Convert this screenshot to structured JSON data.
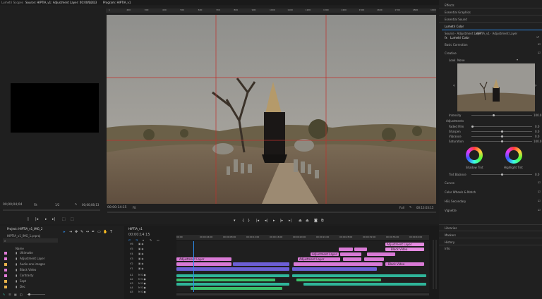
{
  "top_tabs": {
    "left_tab": "Lumetri Scopes",
    "source_tab": "Source: HIPTIA_v1: Adjustment Layer: 00:00:10:13",
    "audio_tab": "Audi",
    "program_tab": "Program: HIPTIA_v1"
  },
  "ruler_labels": [
    "1",
    "200",
    "300",
    "400",
    "500",
    "600",
    "700",
    "800",
    "900",
    "1000",
    "1100",
    "1200",
    "1300",
    "1400",
    "1500",
    "1600",
    "1700",
    "1800",
    "1900"
  ],
  "source_monitor": {
    "timecode": "00;00;04;04",
    "fit": "Fit",
    "resolution": "1/2",
    "duration": "00;00;08;13"
  },
  "program_monitor": {
    "timecode": "00:00:14:15",
    "fit": "Fit",
    "resolution": "Full",
    "duration": "00:13:03:15"
  },
  "right_panel": {
    "effects": "Effects",
    "essential_graphics": "Essential Graphics",
    "essential_sound": "Essential Sound",
    "lumetri_color": "Lumetri Color",
    "source_line": "Source · Adjustment Layer",
    "sequence_line": "HIPTIA_v1 · Adjustment Layer",
    "effect_name": "Lumetri Color",
    "basic_correction": "Basic Correction",
    "creative": "Creative",
    "look_label": "Look",
    "look_value": "None",
    "intensity": "Intensity",
    "intensity_val": "100.0",
    "adjustments": "Adjustments",
    "faded_film": "Faded Film",
    "faded_film_val": "0.0",
    "sharpen": "Sharpen",
    "sharpen_val": "0.0",
    "vibrance": "Vibrance",
    "vibrance_val": "0.0",
    "saturation": "Saturation",
    "saturation_val": "100.0",
    "shadow_tint": "Shadow Tint",
    "highlight_tint": "Highlight Tint",
    "tint_balance": "Tint Balance",
    "tint_balance_val": "0.0",
    "curves": "Curves",
    "color_wheels": "Color Wheels & Match",
    "hsl_secondary": "HSL Secondary",
    "vignette": "Vignette",
    "libraries": "Libraries",
    "markers": "Markers",
    "history": "History",
    "info": "Info"
  },
  "project_panel": {
    "tab": "Project: HIPTIA_v1_IMG_2",
    "file": "HIPTIA_v1_IMG_1.prproj",
    "name_header": "Name",
    "items": [
      {
        "name": "Ultimatte",
        "color": "#e07ad6"
      },
      {
        "name": "Adjustment Layer",
        "color": "#e07ad6"
      },
      {
        "name": "Audio one images",
        "color": "#e8b24a"
      },
      {
        "name": "Black Video",
        "color": "#e07ad6"
      },
      {
        "name": "Contrasty",
        "color": "#e07ad6"
      },
      {
        "name": "Sept",
        "color": "#e8b24a"
      },
      {
        "name": "Dec",
        "color": "#e8b24a"
      }
    ]
  },
  "timeline": {
    "tab": "HIPTIA_v1",
    "timecode": "00:00:14:15",
    "ruler_times": [
      "00:00",
      "00:00:04:00",
      "00:00:08:00",
      "00:00:12:00",
      "00:00:16:00",
      "00:00:20:00",
      "00:00:24:00",
      "00:00:28:00",
      "00:00:32:00",
      "00:00:36:00",
      "00:00:40:00"
    ],
    "video_tracks": [
      "V6",
      "V5",
      "V4",
      "V3",
      "V2",
      "V1"
    ],
    "audio_tracks": [
      "A1",
      "A2",
      "A3",
      "A4",
      "A5"
    ],
    "clip_labels": {
      "adjustment_layer_1": "Adjustment Layer",
      "black_video": "Black Video",
      "adjustment_layer_2": "Adjustment Layer",
      "adjustment_layer_3": "Adjustment Layer",
      "adjustment_layer_4": "Adjustment Layer",
      "black_video_2": "Black Video",
      "adjustment_layer_5": "Adjustment Layer"
    }
  },
  "colors": {
    "accent": "#2d8ceb",
    "pink_clip": "#d97ad6",
    "purple_clip": "#6c5fd6",
    "teal_clip": "#2fb59a",
    "green_clip": "#3ac06a"
  }
}
